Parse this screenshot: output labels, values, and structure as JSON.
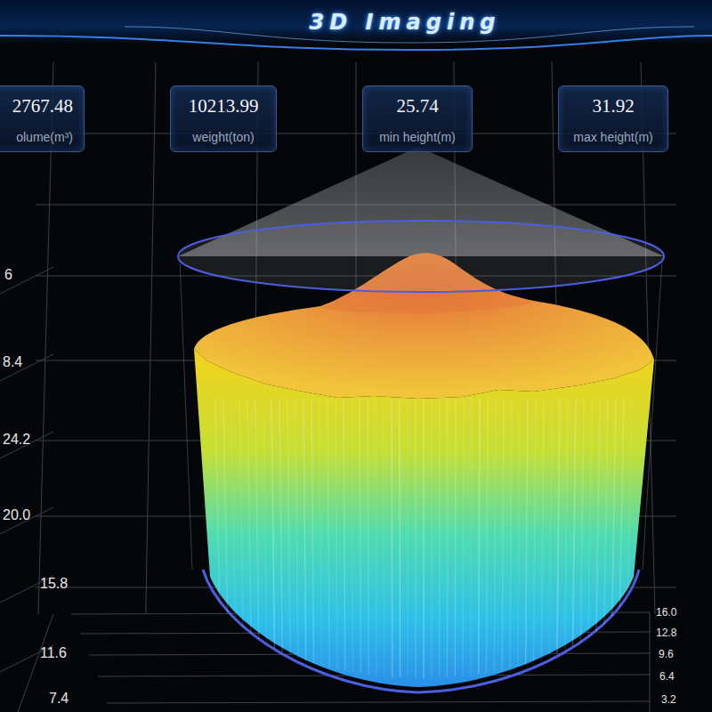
{
  "header": {
    "title": "3D Imaging"
  },
  "stats": [
    {
      "value": "2767.48",
      "label": "olume(m³)"
    },
    {
      "value": "10213.99",
      "label": "weight(ton)"
    },
    {
      "value": "25.74",
      "label": "min height(m)"
    },
    {
      "value": "31.92",
      "label": "max height(m)"
    }
  ],
  "axis_left": {
    "ticks": [
      "6",
      "8.4",
      "24.2",
      "20.0",
      "15.8",
      "11.6",
      "7.4"
    ]
  },
  "axis_right": {
    "ticks": [
      "16.0",
      "12.8",
      "9.6",
      "6.4",
      "3.2"
    ]
  }
}
